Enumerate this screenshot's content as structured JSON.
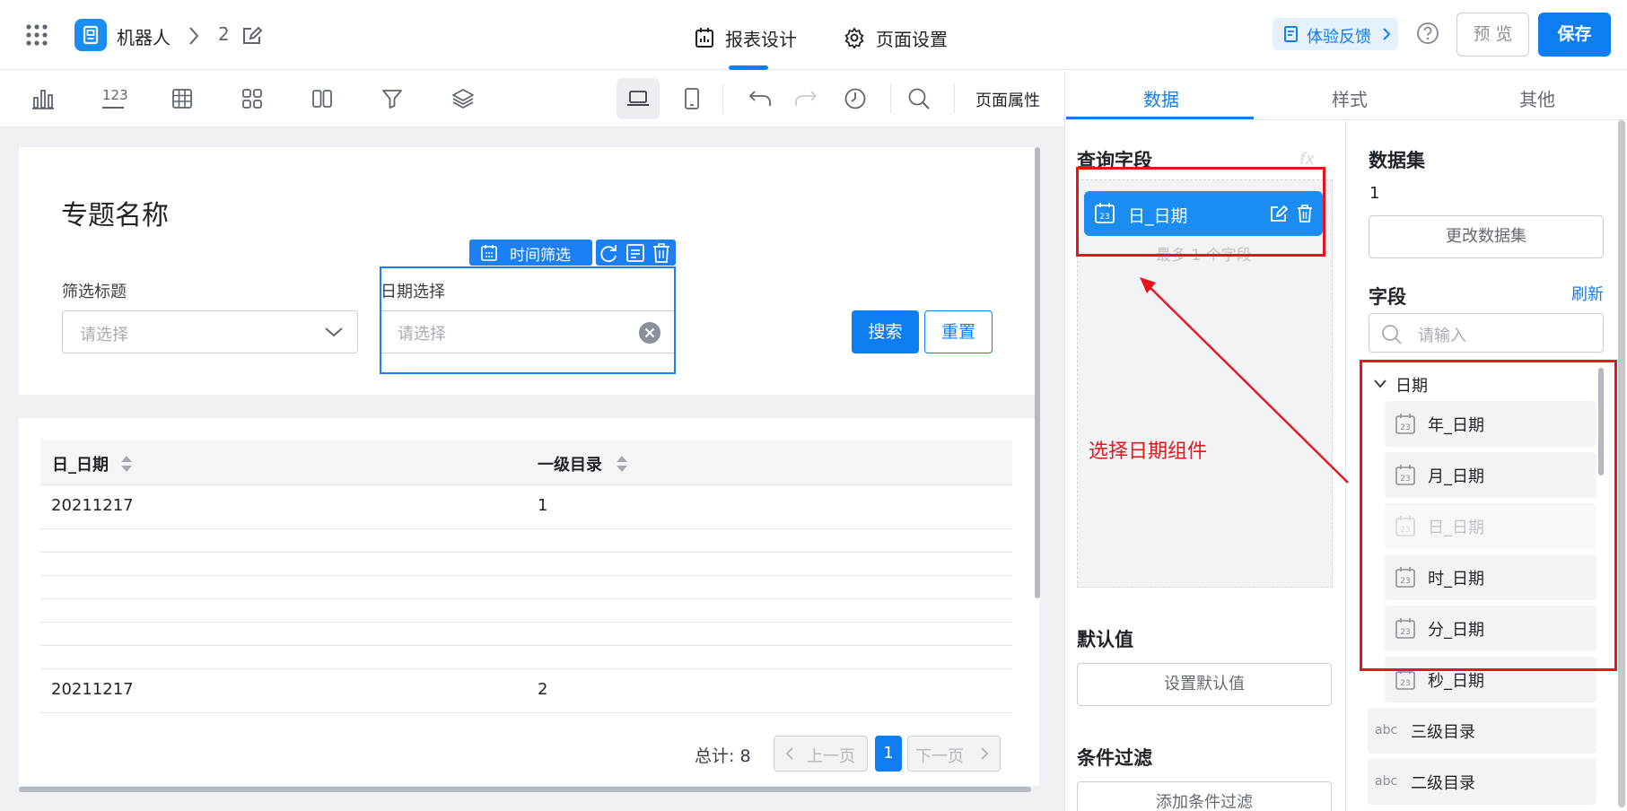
{
  "header": {
    "app_name": "机器人",
    "breadcrumb_page": "2",
    "tabs": [
      {
        "label": "报表设计"
      },
      {
        "label": "页面设置"
      }
    ],
    "feedback_label": "体验反馈",
    "preview_label": "预 览",
    "save_label": "保存"
  },
  "toolbar": {
    "number_icon_text": "123",
    "page_props_label": "页面属性"
  },
  "report": {
    "title": "专题名称",
    "filter1": {
      "label": "筛选标题",
      "placeholder": "请选择"
    },
    "filter2": {
      "label": "日期选择",
      "placeholder": "请选择"
    },
    "component_tag": "时间筛选",
    "search_label": "搜索",
    "reset_label": "重置",
    "table": {
      "columns": [
        "日_日期",
        "一级目录"
      ],
      "rows": [
        [
          "20211217",
          "1"
        ],
        [
          "20211217",
          "2"
        ]
      ]
    },
    "pager": {
      "total_label": "总计: 8",
      "prev_label": "上一页",
      "page": "1",
      "next_label": "下一页"
    }
  },
  "right_panel": {
    "tabs": [
      {
        "label": "数据"
      },
      {
        "label": "样式"
      },
      {
        "label": "其他"
      }
    ],
    "query_fields": {
      "title": "查询字段",
      "fx_label": "fx",
      "chip_label": "日_日期",
      "hint": "最多 1 个字段"
    },
    "default_value": {
      "title": "默认值",
      "button": "设置默认值"
    },
    "condition_filter": {
      "title": "条件过滤",
      "button": "添加条件过滤"
    },
    "dataset": {
      "title": "数据集",
      "value": "1",
      "change_button": "更改数据集"
    },
    "fields": {
      "title": "字段",
      "refresh_label": "刷新",
      "search_placeholder": "请输入",
      "group_label": "日期",
      "date_icon_text": "23",
      "items": [
        "年_日期",
        "月_日期",
        "日_日期",
        "时_日期",
        "分_日期",
        "秒_日期"
      ],
      "text_type_label": "abc",
      "other_items": [
        "三级目录",
        "二级目录"
      ]
    }
  },
  "annotation": {
    "text": "选择日期组件",
    "color": "#e8141b"
  },
  "colors": {
    "primary": "#0f7df2",
    "chip": "#1b8cf2",
    "highlight_red": "#e8141b"
  }
}
